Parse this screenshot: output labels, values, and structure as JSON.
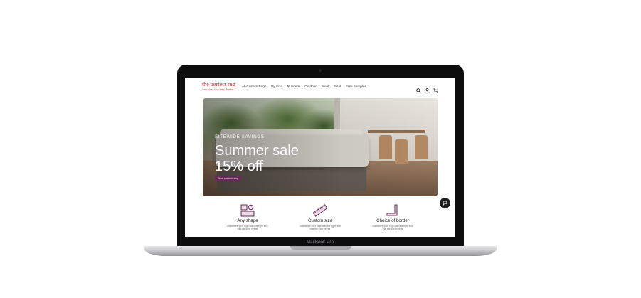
{
  "device": {
    "label": "MacBook Pro"
  },
  "site": {
    "logo": {
      "name": "the perfect rug",
      "tagline": "Your size. Your way. Perfect."
    },
    "nav": [
      "All Custom Rugs",
      "By Size",
      "Runners",
      "Outdoor",
      "Wool",
      "Sisal",
      "Free Samples"
    ],
    "icons": [
      "search-icon",
      "account-icon",
      "cart-icon"
    ]
  },
  "hero": {
    "eyebrow": "SITEWIDE SAVINGS",
    "headline_line1": "Summer sale",
    "headline_line2": "15% off",
    "cta": "Start customizing"
  },
  "features": [
    {
      "title": "Any shape",
      "desc_line1": "customize your rugs with the right size",
      "desc_line2": "that fits your needs",
      "icon": "shapes-icon"
    },
    {
      "title": "Custom size",
      "desc_line1": "customize your rugs with the right size",
      "desc_line2": "that fits your needs",
      "icon": "ruler-icon"
    },
    {
      "title": "Choice of border",
      "desc_line1": "customize your rugs with the right size",
      "desc_line2": "that fits your needs",
      "icon": "border-corner-icon"
    }
  ],
  "colors": {
    "brand_red": "#c8232c",
    "cta_purple": "#6a2a57",
    "feature_icon": "#6a2a57"
  }
}
